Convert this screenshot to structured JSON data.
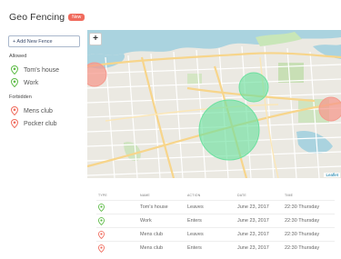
{
  "header": {
    "title": "Geo Fencing",
    "badge": "New"
  },
  "sidebar": {
    "add_button": "+ Add New Fence",
    "allowed_label": "Allowed",
    "allowed": [
      {
        "label": "Tom's house",
        "color": "#5dbb46"
      },
      {
        "label": "Work",
        "color": "#5dbb46"
      }
    ],
    "forbidden_label": "Forbidden",
    "forbidden": [
      {
        "label": "Mens club",
        "color": "#f06b5d"
      },
      {
        "label": "Pocker club",
        "color": "#f06b5d"
      }
    ]
  },
  "map": {
    "zoom_in": "+",
    "attribution": "Leaflet",
    "allowed_color": "#6ee0a0",
    "forbidden_color": "#f59a8e"
  },
  "table": {
    "headers": [
      "Type",
      "Name",
      "Action",
      "Date",
      "Time"
    ],
    "rows": [
      {
        "type": "allowed",
        "name": "Tom's house",
        "action": "Leaves",
        "date": "June 23, 2017",
        "time": "22:30 Thursday"
      },
      {
        "type": "allowed",
        "name": "Work",
        "action": "Enters",
        "date": "June 23, 2017",
        "time": "22:30 Thursday"
      },
      {
        "type": "forbidden",
        "name": "Mens club",
        "action": "Leaves",
        "date": "June 23, 2017",
        "time": "22:30 Thursday"
      },
      {
        "type": "forbidden",
        "name": "Mens club",
        "action": "Enters",
        "date": "June 23, 2017",
        "time": "22:30 Thursday"
      }
    ]
  }
}
